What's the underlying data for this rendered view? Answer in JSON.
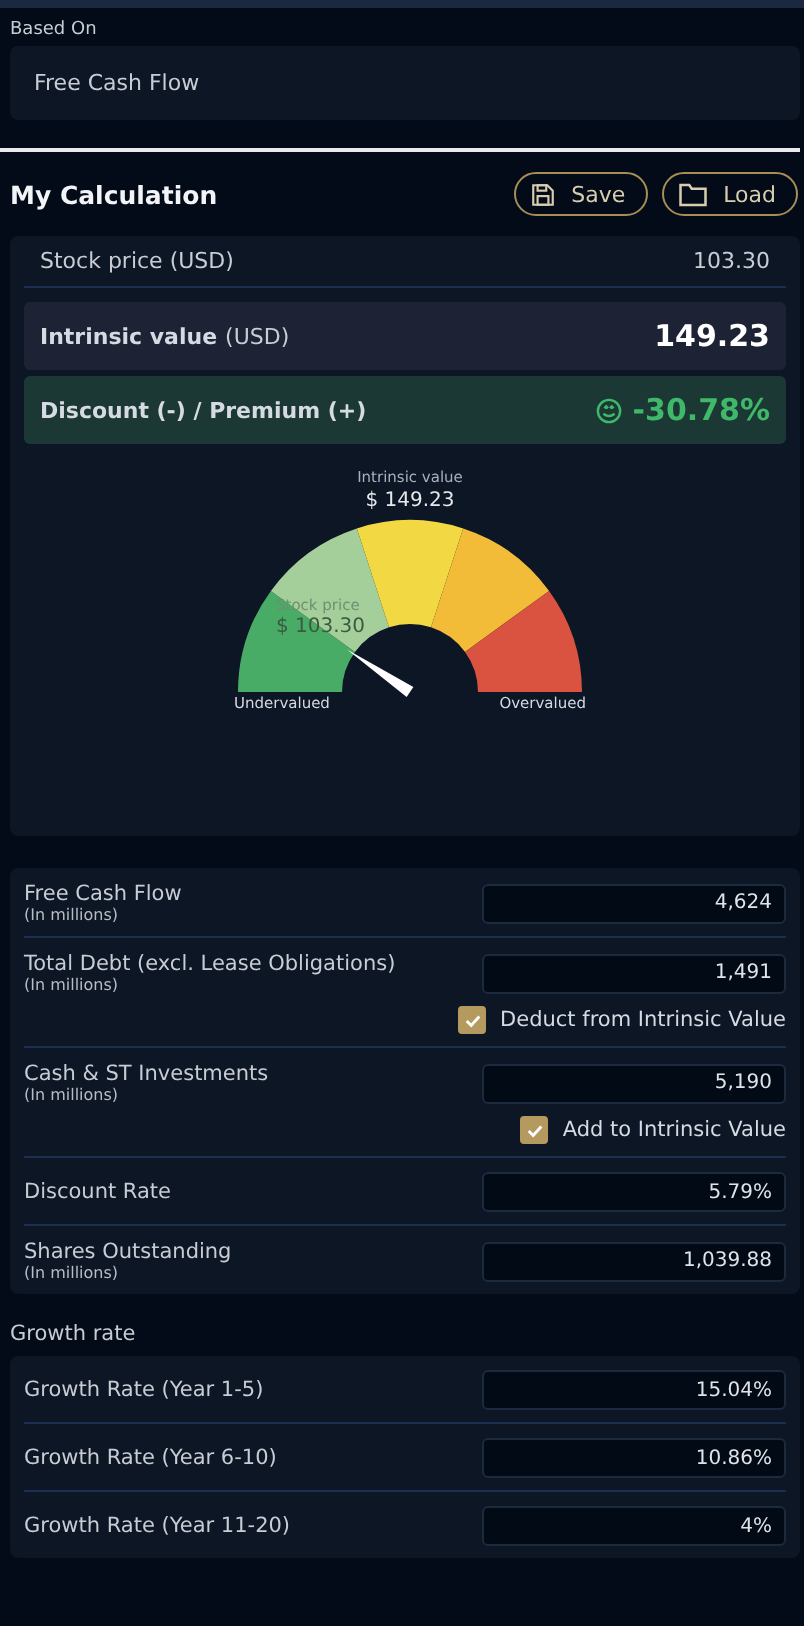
{
  "based_on": {
    "label": "Based On",
    "value": "Free Cash Flow"
  },
  "calculation": {
    "title": "My Calculation",
    "buttons": [
      {
        "label": "Save",
        "kind": "save"
      },
      {
        "label": "Load",
        "kind": "load"
      }
    ],
    "stock_price": {
      "label": "Stock price (USD)",
      "value": "103.30"
    },
    "intrinsic": {
      "label": "Intrinsic value",
      "unit": "(USD)",
      "value": "149.23"
    },
    "discount": {
      "label": "Discount (-) / Premium (+)",
      "value": "-30.78%"
    },
    "gauge": {
      "top_label": "Intrinsic value",
      "top_value": "$ 149.23",
      "needle_label": "Stock price",
      "needle_value": "$ 103.30",
      "left_label": "Undervalued",
      "right_label": "Overvalued"
    }
  },
  "inputs": [
    {
      "label": "Free Cash Flow",
      "note": "(In millions)",
      "value": "4,624"
    },
    {
      "label": "Total Debt (excl. Lease Obligations)",
      "note": "(In millions)",
      "value": "1,491",
      "checkbox": {
        "label": "Deduct from Intrinsic Value",
        "checked": true
      }
    },
    {
      "label": "Cash & ST Investments",
      "note": "(In millions)",
      "value": "5,190",
      "checkbox": {
        "label": "Add to Intrinsic Value",
        "checked": true
      }
    },
    {
      "label": "Discount Rate",
      "value": "5.79%"
    },
    {
      "label": "Shares Outstanding",
      "note": "(In millions)",
      "value": "1,039.88"
    }
  ],
  "growth": {
    "title": "Growth rate",
    "rows": [
      {
        "label": "Growth Rate (Year 1-5)",
        "value": "15.04%"
      },
      {
        "label": "Growth Rate (Year 6-10)",
        "value": "10.86%"
      },
      {
        "label": "Growth Rate (Year 11-20)",
        "value": "4%"
      }
    ]
  }
}
